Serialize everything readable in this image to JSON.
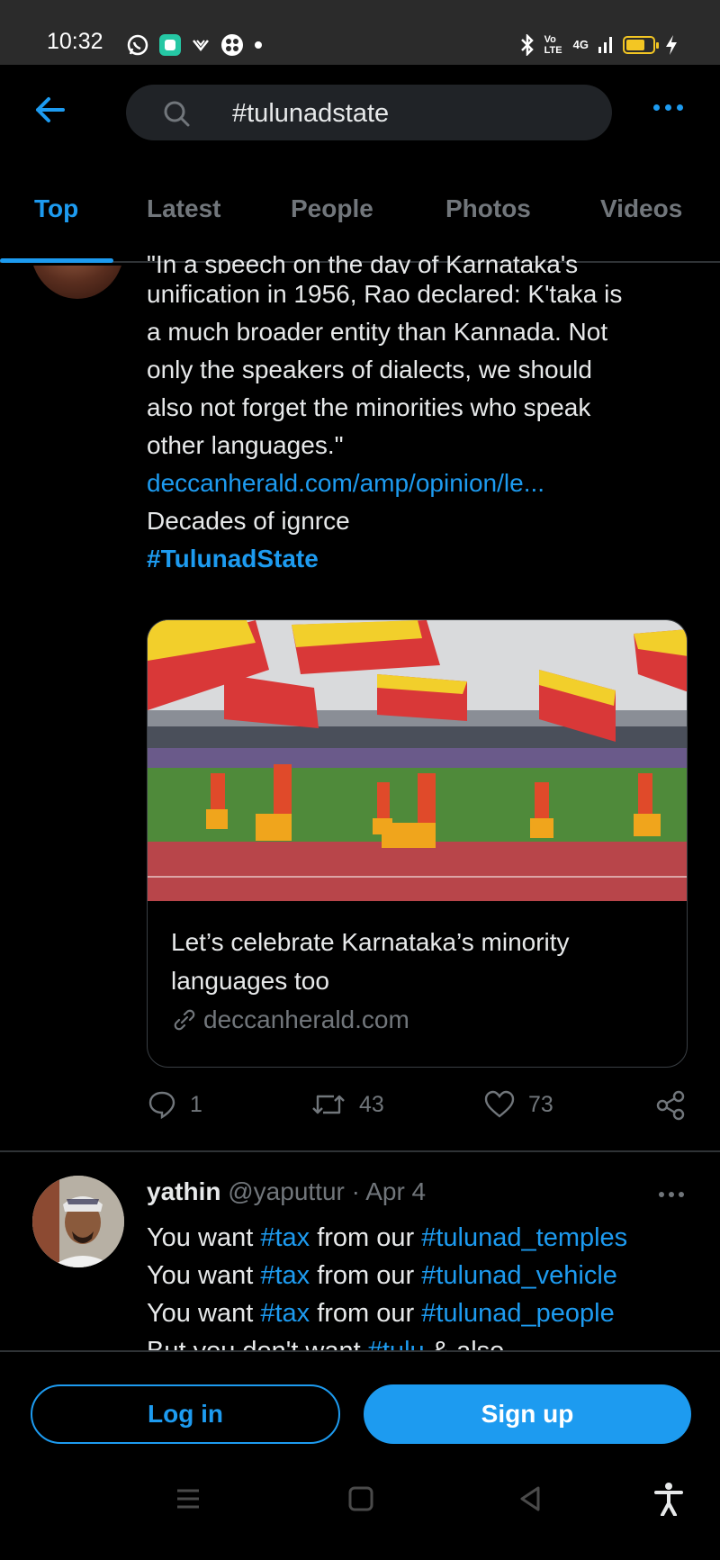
{
  "status_bar": {
    "time": "10:32",
    "network": "4G",
    "volte": "Vo LTE",
    "left_icons": [
      "whatsapp-icon",
      "app-icon",
      "cast-icon",
      "flower-icon",
      "dot-icon"
    ],
    "right_icons": [
      "bluetooth-icon",
      "volte-icon",
      "signal-icon",
      "battery-icon",
      "charging-icon"
    ],
    "battery_level": 0.55
  },
  "header": {
    "search_value": "#tulunadstate"
  },
  "tabs": [
    {
      "label": "Top",
      "active": true
    },
    {
      "label": "Latest",
      "active": false
    },
    {
      "label": "People",
      "active": false
    },
    {
      "label": "Photos",
      "active": false
    },
    {
      "label": "Videos",
      "active": false
    }
  ],
  "tweet1": {
    "lines": [
      "\"In a speech on the day of Karnataka's",
      "unification in 1956, Rao declared: K'taka is",
      "a much broader entity than Kannada. Not",
      "only the speakers of dialects, we should",
      "also not forget the minorities who speak",
      "other languages.\""
    ],
    "link": "deccanherald.com/amp/opinion/le...",
    "comment": "Decades of ignrce",
    "hashtag": "#TulunadState",
    "card": {
      "title": "Let’s celebrate Karnataka’s minority languages too",
      "domain": "deccanherald.com"
    },
    "replies": "1",
    "retweets": "43",
    "likes": "73"
  },
  "tweet2": {
    "name": "yathin",
    "handle": "@yaputtur",
    "date": "· Apr 4",
    "lines": [
      {
        "prefix": "You want ",
        "tag1": "#tax",
        "mid": " from our ",
        "tag2": "#tulunad_temples"
      },
      {
        "prefix": "You want ",
        "tag1": "#tax",
        "mid": " from our ",
        "tag2": "#tulunad_vehicle"
      },
      {
        "prefix": "You want ",
        "tag1": "#tax",
        "mid": " from our ",
        "tag2": "#tulunad_people"
      },
      {
        "prefix": "But you don't want ",
        "tag1": "#tulu",
        "mid": " & also",
        "tag2": ""
      }
    ]
  },
  "bottom": {
    "login_label": "Log in",
    "signup_label": "Sign up"
  },
  "colors": {
    "accent": "#1d9bf0",
    "muted": "#71767b",
    "text": "#e7e9ea",
    "background": "#000000"
  }
}
